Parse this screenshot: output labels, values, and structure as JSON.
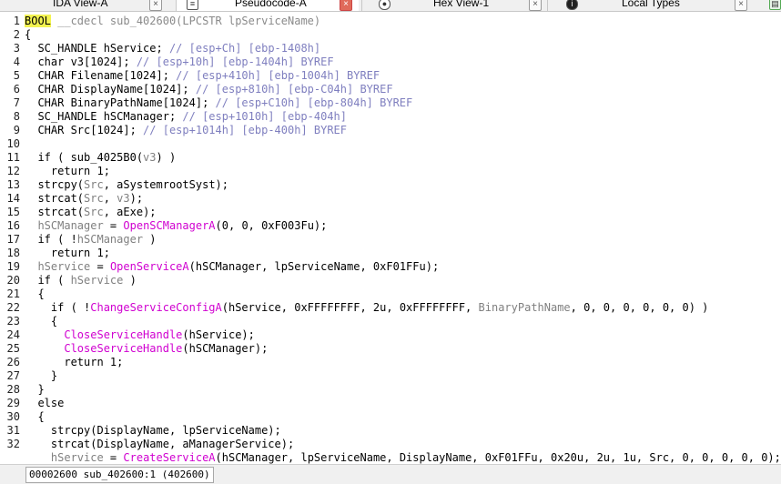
{
  "tabs": [
    {
      "label": "IDA View-A",
      "close": "×",
      "icon": "disassembly-icon"
    },
    {
      "label": "Pseudocode-A",
      "close": "×",
      "icon": "pseudocode-icon",
      "active": true
    },
    {
      "label": "Hex View-1",
      "close": "×",
      "icon": "hex-view-icon"
    },
    {
      "label": "Local Types",
      "close": "×",
      "icon": "local-types-icon"
    }
  ],
  "code": {
    "lines": [
      {
        "n": "1",
        "parts": [
          [
            "BOOL",
            "kw-bool"
          ],
          [
            " __cdecl sub_402600(LPCSTR lpServiceName)",
            "t-gray"
          ]
        ]
      },
      {
        "n": "2",
        "parts": [
          [
            "{",
            ""
          ]
        ]
      },
      {
        "n": "3",
        "parts": [
          [
            "  SC_HANDLE hService; ",
            ""
          ],
          [
            "// [esp+Ch] [ebp-1408h]",
            "t-comment"
          ]
        ]
      },
      {
        "n": "4",
        "parts": [
          [
            "  char v3[1024]; ",
            ""
          ],
          [
            "// [esp+10h] [ebp-1404h] BYREF",
            "t-comment"
          ]
        ]
      },
      {
        "n": "5",
        "parts": [
          [
            "  CHAR Filename[1024]; ",
            ""
          ],
          [
            "// [esp+410h] [ebp-1004h] BYREF",
            "t-comment"
          ]
        ]
      },
      {
        "n": "6",
        "parts": [
          [
            "  CHAR DisplayName[1024]; ",
            ""
          ],
          [
            "// [esp+810h] [ebp-C04h] BYREF",
            "t-comment"
          ]
        ]
      },
      {
        "n": "7",
        "parts": [
          [
            "  CHAR BinaryPathName[1024]; ",
            ""
          ],
          [
            "// [esp+C10h] [ebp-804h] BYREF",
            "t-comment"
          ]
        ]
      },
      {
        "n": "8",
        "parts": [
          [
            "  SC_HANDLE hSCManager; ",
            ""
          ],
          [
            "// [esp+1010h] [ebp-404h]",
            "t-comment"
          ]
        ]
      },
      {
        "n": "9",
        "parts": [
          [
            "  CHAR Src[1024]; ",
            ""
          ],
          [
            "// [esp+1014h] [ebp-400h] BYREF",
            "t-comment"
          ]
        ]
      },
      {
        "n": "10",
        "parts": [
          [
            "",
            ""
          ]
        ]
      },
      {
        "n": "11",
        "parts": [
          [
            "  if ( sub_4025B0(",
            ""
          ],
          [
            "v3",
            "t-var"
          ],
          [
            ") )",
            ""
          ]
        ]
      },
      {
        "n": "12",
        "parts": [
          [
            "    return 1;",
            ""
          ]
        ]
      },
      {
        "n": "13",
        "parts": [
          [
            "  strcpy(",
            ""
          ],
          [
            "Src",
            "t-var"
          ],
          [
            ", aSystemrootSyst);",
            ""
          ]
        ]
      },
      {
        "n": "14",
        "parts": [
          [
            "  strcat(",
            ""
          ],
          [
            "Src",
            "t-var"
          ],
          [
            ", ",
            ""
          ],
          [
            "v3",
            "t-var"
          ],
          [
            ");",
            ""
          ]
        ]
      },
      {
        "n": "15",
        "parts": [
          [
            "  strcat(",
            ""
          ],
          [
            "Src",
            "t-var"
          ],
          [
            ", aExe);",
            ""
          ]
        ]
      },
      {
        "n": "16",
        "parts": [
          [
            "  ",
            ""
          ],
          [
            "hSCManager",
            "t-var"
          ],
          [
            " = ",
            ""
          ],
          [
            "OpenSCManagerA",
            "t-func"
          ],
          [
            "(0, 0, 0xF003Fu);",
            ""
          ]
        ]
      },
      {
        "n": "17",
        "parts": [
          [
            "  if ( !",
            ""
          ],
          [
            "hSCManager",
            "t-var"
          ],
          [
            " )",
            ""
          ]
        ]
      },
      {
        "n": "18",
        "parts": [
          [
            "    return 1;",
            ""
          ]
        ]
      },
      {
        "n": "19",
        "parts": [
          [
            "  ",
            ""
          ],
          [
            "hService",
            "t-var"
          ],
          [
            " = ",
            ""
          ],
          [
            "OpenServiceA",
            "t-func"
          ],
          [
            "(hSCManager, lpServiceName, 0xF01FFu);",
            ""
          ]
        ]
      },
      {
        "n": "20",
        "parts": [
          [
            "  if ( ",
            ""
          ],
          [
            "hService",
            "t-var"
          ],
          [
            " )",
            ""
          ]
        ]
      },
      {
        "n": "21",
        "parts": [
          [
            "  {",
            ""
          ]
        ]
      },
      {
        "n": "22",
        "parts": [
          [
            "    if ( !",
            ""
          ],
          [
            "ChangeServiceConfigA",
            "t-func"
          ],
          [
            "(hService, 0xFFFFFFFF, 2u, 0xFFFFFFFF, ",
            ""
          ],
          [
            "BinaryPathName",
            "t-var"
          ],
          [
            ", 0, 0, 0, 0, 0, 0) )",
            ""
          ]
        ]
      },
      {
        "n": "23",
        "parts": [
          [
            "    {",
            ""
          ]
        ]
      },
      {
        "n": "24",
        "parts": [
          [
            "      ",
            ""
          ],
          [
            "CloseServiceHandle",
            "t-func"
          ],
          [
            "(hService);",
            ""
          ]
        ]
      },
      {
        "n": "25",
        "parts": [
          [
            "      ",
            ""
          ],
          [
            "CloseServiceHandle",
            "t-func"
          ],
          [
            "(hSCManager);",
            ""
          ]
        ]
      },
      {
        "n": "26",
        "parts": [
          [
            "      return 1;",
            ""
          ]
        ]
      },
      {
        "n": "27",
        "parts": [
          [
            "    }",
            ""
          ]
        ]
      },
      {
        "n": "28",
        "parts": [
          [
            "  }",
            ""
          ]
        ]
      },
      {
        "n": "29",
        "parts": [
          [
            "  else",
            ""
          ]
        ]
      },
      {
        "n": "30",
        "parts": [
          [
            "  {",
            ""
          ]
        ]
      },
      {
        "n": "31",
        "parts": [
          [
            "    strcpy(DisplayName, lpServiceName);",
            ""
          ]
        ]
      },
      {
        "n": "32",
        "parts": [
          [
            "    strcat(DisplayName, aManagerService);",
            ""
          ]
        ]
      },
      {
        "n": "",
        "parts": [
          [
            "    ",
            ""
          ],
          [
            "hService",
            "t-var"
          ],
          [
            " = ",
            ""
          ],
          [
            "CreateServiceA",
            "t-func"
          ],
          [
            "(hSCManager, lpServiceName, DisplayName, 0xF01FFu, 0x20u, 2u, 1u, Src, 0, 0, 0, 0, 0);",
            ""
          ]
        ]
      }
    ]
  },
  "status": {
    "location": "00002600 sub_402600:1 (402600)"
  },
  "colors": {
    "keyword_highlight": "#f3f350",
    "comment": "#7f7fbf",
    "function": "#d000d0",
    "variable": "#808080"
  }
}
